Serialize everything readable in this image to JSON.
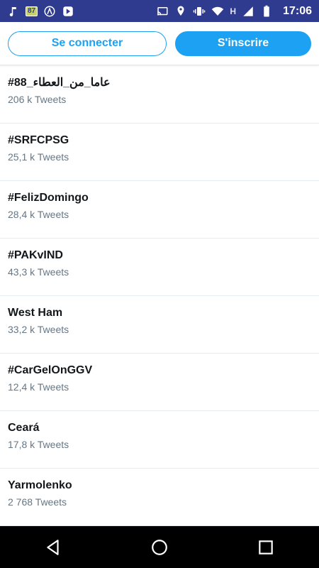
{
  "status_bar": {
    "time": "17:06",
    "battery_indicator": "87",
    "network_type": "H",
    "icons_left": [
      "music-icon",
      "battery-icon",
      "app-icon",
      "notification-icon"
    ],
    "icons_right": [
      "cast-icon",
      "location-icon",
      "vibrate-icon",
      "wifi-icon",
      "signal-icon",
      "battery-icon"
    ]
  },
  "auth": {
    "login_label": "Se connecter",
    "signup_label": "S'inscrire"
  },
  "colors": {
    "accent": "#1da1f2",
    "status_bar": "#2f3b8f",
    "text_primary": "#14171a",
    "text_secondary": "#657786"
  },
  "trends": [
    {
      "name": "#88_عاما_من_العطاء",
      "count": "206 k Tweets"
    },
    {
      "name": "#SRFCPSG",
      "count": "25,1 k Tweets"
    },
    {
      "name": "#FelizDomingo",
      "count": "28,4 k Tweets"
    },
    {
      "name": "#PAKvIND",
      "count": "43,3 k Tweets"
    },
    {
      "name": "West Ham",
      "count": "33,2 k Tweets"
    },
    {
      "name": "#CarGelOnGGV",
      "count": "12,4 k Tweets"
    },
    {
      "name": "Ceará",
      "count": "17,8 k Tweets"
    },
    {
      "name": "Yarmolenko",
      "count": "2 768 Tweets"
    }
  ],
  "nav_bar": {
    "icons": [
      "back-icon",
      "home-icon",
      "recents-icon"
    ]
  }
}
